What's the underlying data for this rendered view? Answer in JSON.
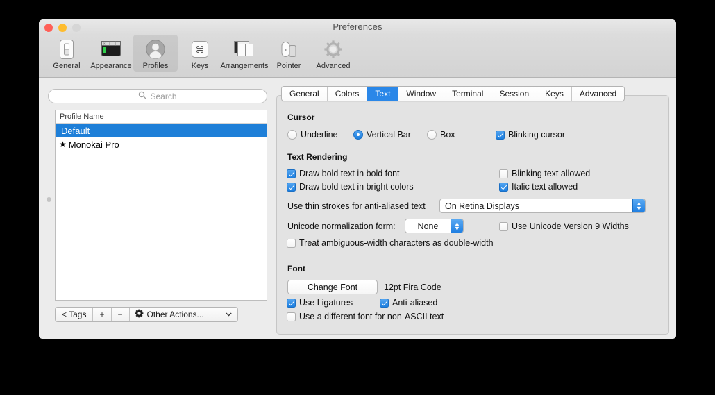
{
  "window": {
    "title": "Preferences",
    "traffic": {
      "close": "close-button",
      "minimize": "minimize-button",
      "maximize": "zoom-button"
    }
  },
  "toolbar": {
    "items": [
      {
        "label": "General",
        "icon": "general-icon",
        "selected": false
      },
      {
        "label": "Appearance",
        "icon": "appearance-icon",
        "selected": false
      },
      {
        "label": "Profiles",
        "icon": "profiles-icon",
        "selected": true
      },
      {
        "label": "Keys",
        "icon": "keys-icon",
        "selected": false
      },
      {
        "label": "Arrangements",
        "icon": "arrangements-icon",
        "selected": false
      },
      {
        "label": "Pointer",
        "icon": "pointer-icon",
        "selected": false
      },
      {
        "label": "Advanced",
        "icon": "advanced-icon",
        "selected": false
      }
    ]
  },
  "sidebar": {
    "search": {
      "placeholder": "Search",
      "value": "",
      "icon": "search-icon"
    },
    "list": {
      "header": "Profile Name",
      "rows": [
        {
          "name": "Default",
          "selected": true,
          "starred": false,
          "star": ""
        },
        {
          "name": "Monokai Pro",
          "selected": false,
          "starred": true,
          "star": "★"
        }
      ]
    },
    "buttons": {
      "tags": "< Tags",
      "add": "+",
      "remove": "−",
      "other_actions": "Other Actions...",
      "gear_icon": "gear-icon",
      "chevron": "⌄"
    }
  },
  "tabs": [
    {
      "label": "General",
      "active": false
    },
    {
      "label": "Colors",
      "active": false
    },
    {
      "label": "Text",
      "active": true
    },
    {
      "label": "Window",
      "active": false
    },
    {
      "label": "Terminal",
      "active": false
    },
    {
      "label": "Session",
      "active": false
    },
    {
      "label": "Keys",
      "active": false
    },
    {
      "label": "Advanced",
      "active": false
    }
  ],
  "sections": {
    "cursor": {
      "title": "Cursor",
      "radios": [
        {
          "label": "Underline",
          "checked": false
        },
        {
          "label": "Vertical Bar",
          "checked": true
        },
        {
          "label": "Box",
          "checked": false
        }
      ],
      "blinking": {
        "label": "Blinking cursor",
        "checked": true
      }
    },
    "text_rendering": {
      "title": "Text Rendering",
      "left_checks": [
        {
          "label": "Draw bold text in bold font",
          "checked": true
        },
        {
          "label": "Draw bold text in bright colors",
          "checked": true
        }
      ],
      "right_checks": [
        {
          "label": "Blinking text allowed",
          "checked": false
        },
        {
          "label": "Italic text allowed",
          "checked": true
        }
      ],
      "thin_strokes": {
        "label": "Use thin strokes for anti-aliased text",
        "value": "On Retina Displays"
      },
      "unicode_norm": {
        "label": "Unicode normalization form:",
        "value": "None"
      },
      "unicode9": {
        "label": "Use Unicode Version 9 Widths",
        "checked": false
      },
      "ambiguous": {
        "label": "Treat ambiguous-width characters as double-width",
        "checked": false
      }
    },
    "font": {
      "title": "Font",
      "change_button": "Change Font",
      "current_font": "12pt Fira Code",
      "ligatures": {
        "label": "Use Ligatures",
        "checked": true
      },
      "antialiased": {
        "label": "Anti-aliased",
        "checked": true
      },
      "nonascii": {
        "label": "Use a different font for non-ASCII text",
        "checked": false
      }
    }
  },
  "colors": {
    "accent_blue": "#1d7fe0",
    "selection_blue": "#1e7fd8",
    "tab_active": "#2a87e8",
    "window_bg": "#ececec",
    "panel_bg": "#e3e3e3"
  }
}
